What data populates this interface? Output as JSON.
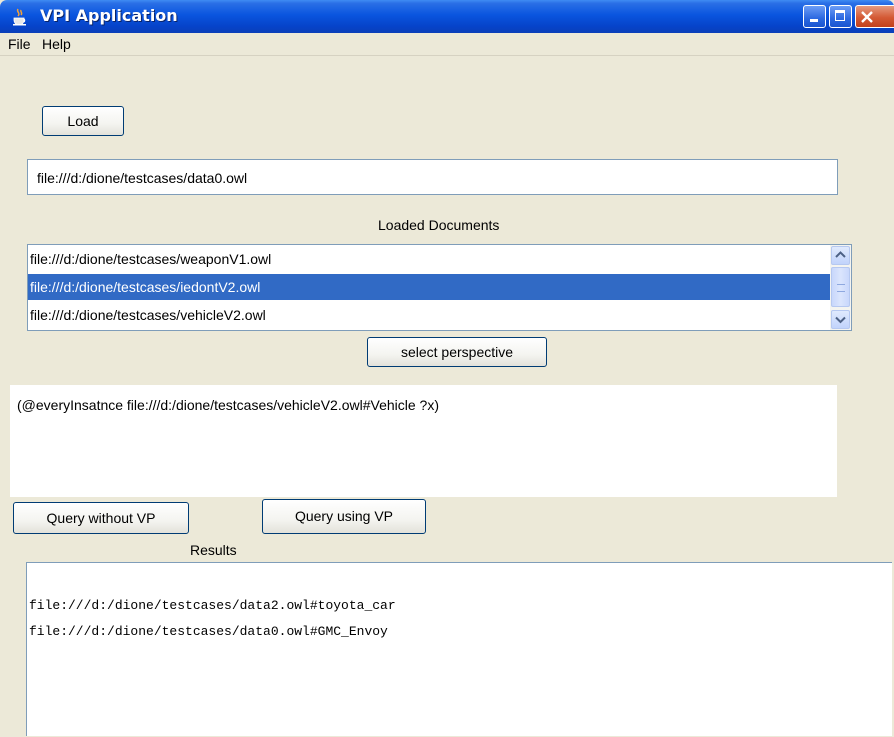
{
  "window": {
    "title": "VPI Application",
    "icon": "java-cup-icon",
    "controls": [
      "minimize-icon",
      "maximize-icon",
      "close-icon"
    ]
  },
  "menu": [
    "File",
    "Help"
  ],
  "load_button": "Load",
  "path_field": {
    "value": "file:///d:/dione/testcases/data0.owl"
  },
  "loaded_documents": {
    "label": "Loaded Documents",
    "items": [
      "file:///d:/dione/testcases/weaponV1.owl",
      "file:///d:/dione/testcases/iedontV2.owl",
      "file:///d:/dione/testcases/vehicleV2.owl"
    ],
    "selected_index": 1
  },
  "select_perspective_button": "select perspective",
  "query": {
    "value": "(@everyInsatnce file:///d:/dione/testcases/vehicleV2.owl#Vehicle ?x)"
  },
  "query_without_vp_button": "Query without VP",
  "query_using_vp_button": "Query using VP",
  "results": {
    "label": "Results",
    "lines": [
      "file:///d:/dione/testcases/data2.owl#toyota_car",
      "file:///d:/dione/testcases/data0.owl#GMC_Envoy"
    ]
  },
  "colors": {
    "titlebar": "#0a55df",
    "selection": "#316ac5",
    "window_bg": "#ece9d8",
    "close_button": "#d45a35"
  }
}
